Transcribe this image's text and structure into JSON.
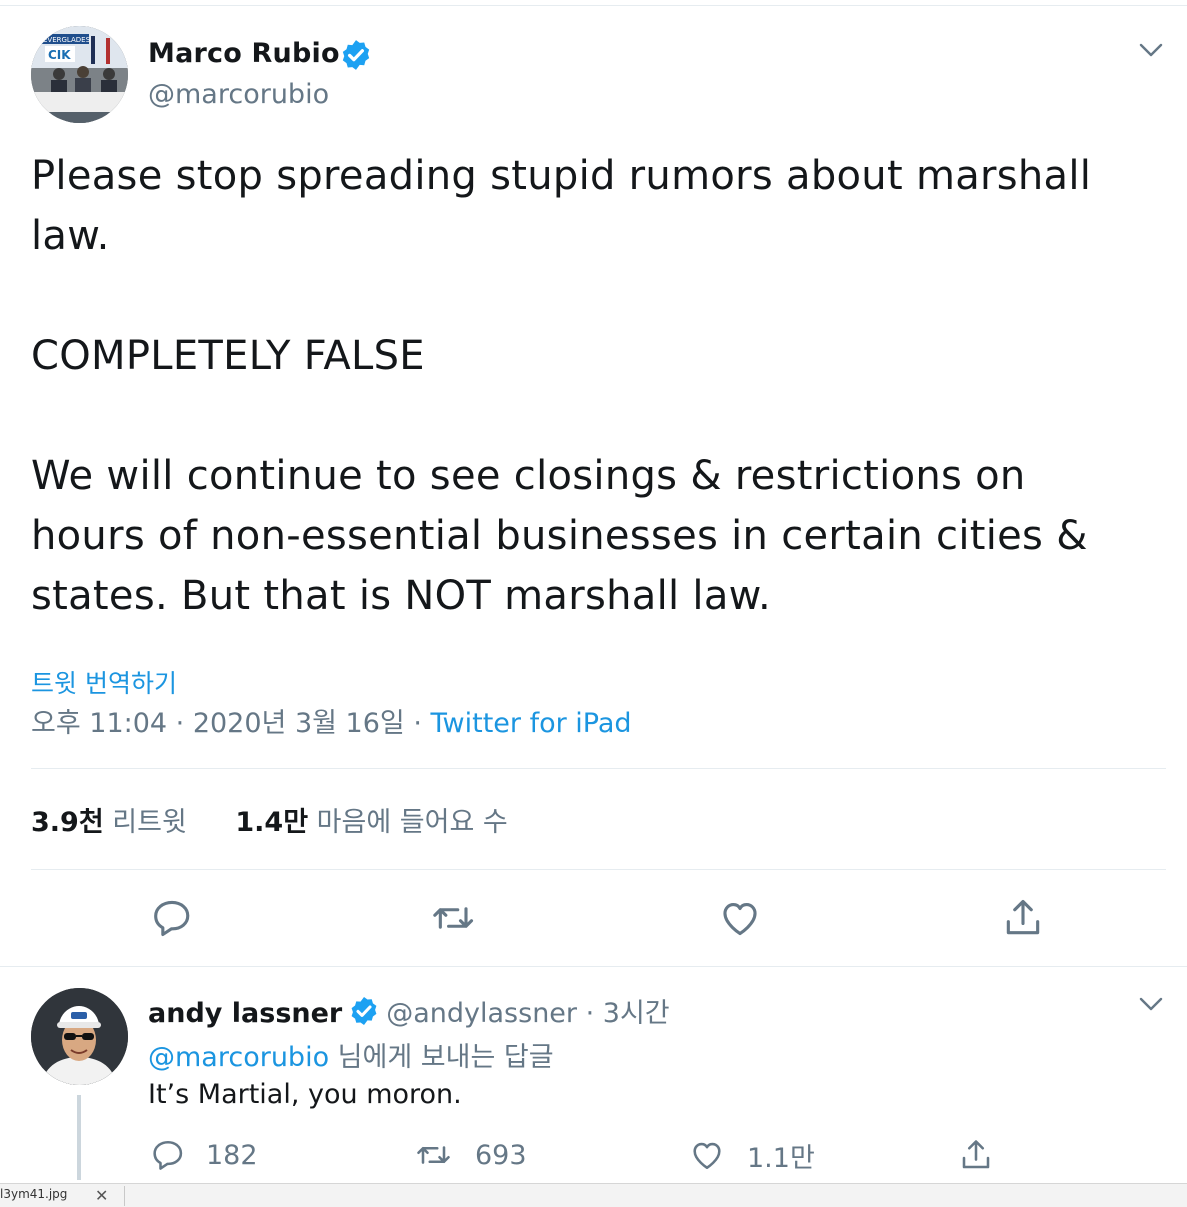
{
  "tweet": {
    "author_name": "Marco Rubio",
    "author_handle": "@marcorubio",
    "avatar_banner_text": "EVERGLADES",
    "avatar_logo_text": "CIK",
    "paragraphs": [
      {
        "lines": [
          "Please stop spreading stupid rumors about marshall",
          "law."
        ]
      },
      {
        "lines": [
          "COMPLETELY FALSE"
        ]
      },
      {
        "lines": [
          "We will continue to see closings & restrictions on",
          "hours of non-essential businesses in certain cities &",
          "states. But that is NOT marshall law."
        ]
      }
    ],
    "translate_label": "트윗 번역하기",
    "timestamp": "오후 11:04 · 2020년 3월 16일 · ",
    "source": "Twitter for iPad",
    "retweets_count": "3.9천",
    "retweets_label": "리트윗",
    "likes_count": "1.4만",
    "likes_label": "마음에 들어요 수"
  },
  "reply": {
    "author_name": "andy lassner",
    "author_handle_time": "@andylassner · 3시간",
    "replying_to_mention": "@marcorubio",
    "replying_to_suffix": " 님에게 보내는 답글",
    "text": "It’s Martial, you moron.",
    "reply_count": "182",
    "retweet_count": "693",
    "like_count": "1.1만"
  },
  "taskbar": {
    "filename": "l3ym41.jpg",
    "close_glyph": "✕"
  },
  "colors": {
    "link": "#1b95e0",
    "verified": "#1da1f2",
    "secondary_text": "#657786",
    "primary_text": "#14171a",
    "divider": "#e6ecf0"
  }
}
